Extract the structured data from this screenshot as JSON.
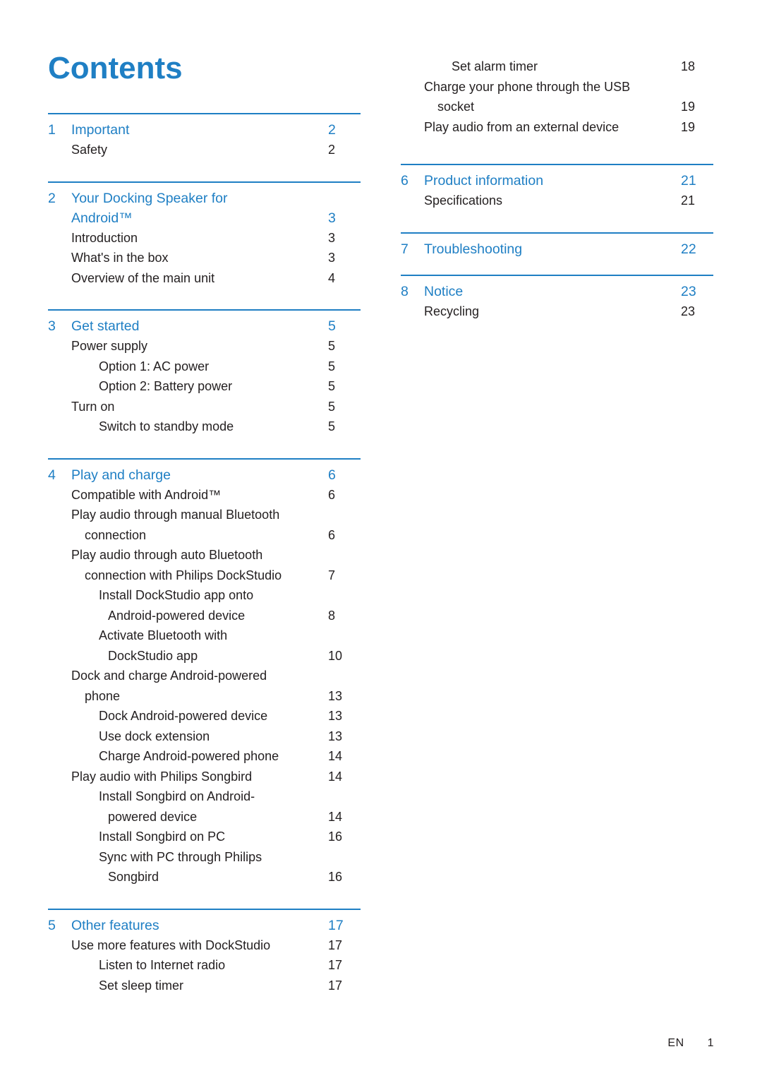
{
  "page_title": "Contents",
  "footer": {
    "locale": "EN",
    "page_number": "1"
  },
  "colors": {
    "accent": "#1f7fc4",
    "text": "#231f20",
    "rule": "#1f7fc4"
  },
  "left_column": [
    {
      "number": "1",
      "label": "Important",
      "page": "2",
      "entries": [
        {
          "level": 1,
          "text": "Safety",
          "page": "2"
        }
      ]
    },
    {
      "number": "2",
      "label": "Your Docking Speaker for",
      "label2": "Android™",
      "page": "3",
      "entries": [
        {
          "level": 1,
          "text": "Introduction",
          "page": "3"
        },
        {
          "level": 1,
          "text": "What's in the box",
          "page": "3"
        },
        {
          "level": 1,
          "text": "Overview of the main unit",
          "page": "4"
        }
      ]
    },
    {
      "number": "3",
      "label": "Get started",
      "page": "5",
      "entries": [
        {
          "level": 1,
          "text": "Power supply",
          "page": "5"
        },
        {
          "level": 2,
          "text": "Option 1: AC power",
          "page": "5"
        },
        {
          "level": 2,
          "text": "Option 2: Battery power",
          "page": "5"
        },
        {
          "level": 1,
          "text": "Turn on",
          "page": "5"
        },
        {
          "level": 2,
          "text": "Switch to standby mode",
          "page": "5"
        }
      ]
    },
    {
      "number": "4",
      "label": "Play and charge",
      "page": "6",
      "entries": [
        {
          "level": 1,
          "text": "Compatible with Android™",
          "page": "6"
        },
        {
          "level": 1,
          "text": "Play audio through manual Bluetooth",
          "page": ""
        },
        {
          "level": 1,
          "cont": 1,
          "text": "connection",
          "page": "6"
        },
        {
          "level": 1,
          "text": "Play audio through auto Bluetooth",
          "page": ""
        },
        {
          "level": 1,
          "cont": 1,
          "text": "connection with Philips DockStudio",
          "page": "7"
        },
        {
          "level": 2,
          "text": "Install DockStudio app onto",
          "page": ""
        },
        {
          "level": 2,
          "cont": 2,
          "text": "Android-powered device",
          "page": "8"
        },
        {
          "level": 2,
          "text": "Activate Bluetooth with",
          "page": ""
        },
        {
          "level": 2,
          "cont": 2,
          "text": "DockStudio app",
          "page": "10"
        },
        {
          "level": 1,
          "text": "Dock and charge Android-powered",
          "page": ""
        },
        {
          "level": 1,
          "cont": 1,
          "text": "phone",
          "page": "13"
        },
        {
          "level": 2,
          "text": "Dock Android-powered device",
          "page": "13"
        },
        {
          "level": 2,
          "text": "Use dock extension",
          "page": "13"
        },
        {
          "level": 2,
          "text": "Charge Android-powered phone",
          "page": "14"
        },
        {
          "level": 1,
          "text": "Play audio with Philips Songbird",
          "page": "14"
        },
        {
          "level": 2,
          "text": "Install Songbird on Android-",
          "page": ""
        },
        {
          "level": 2,
          "cont": 2,
          "text": "powered device",
          "page": "14"
        },
        {
          "level": 2,
          "text": "Install Songbird on PC",
          "page": "16"
        },
        {
          "level": 2,
          "text": "Sync with PC through Philips",
          "page": ""
        },
        {
          "level": 2,
          "cont": 2,
          "text": "Songbird",
          "page": "16"
        }
      ]
    },
    {
      "number": "5",
      "label": "Other features",
      "page": "17",
      "entries": [
        {
          "level": 1,
          "text": "Use more features with DockStudio",
          "page": "17"
        },
        {
          "level": 2,
          "text": "Listen to Internet radio",
          "page": "17"
        },
        {
          "level": 2,
          "text": "Set sleep timer",
          "page": "17"
        }
      ]
    }
  ],
  "right_column_continued": [
    {
      "level": 2,
      "text": "Set alarm timer",
      "page": "18"
    },
    {
      "level": 1,
      "text": "Charge your phone through the USB",
      "page": ""
    },
    {
      "level": 1,
      "cont": 1,
      "text": "socket",
      "page": "19"
    },
    {
      "level": 1,
      "text": "Play audio from an external device",
      "page": "19"
    }
  ],
  "right_column": [
    {
      "number": "6",
      "label": "Product information",
      "page": "21",
      "entries": [
        {
          "level": 1,
          "text": "Specifications",
          "page": "21"
        }
      ]
    },
    {
      "number": "7",
      "label": "Troubleshooting",
      "page": "22",
      "entries": []
    },
    {
      "number": "8",
      "label": "Notice",
      "page": "23",
      "entries": [
        {
          "level": 1,
          "text": "Recycling",
          "page": "23"
        }
      ]
    }
  ]
}
